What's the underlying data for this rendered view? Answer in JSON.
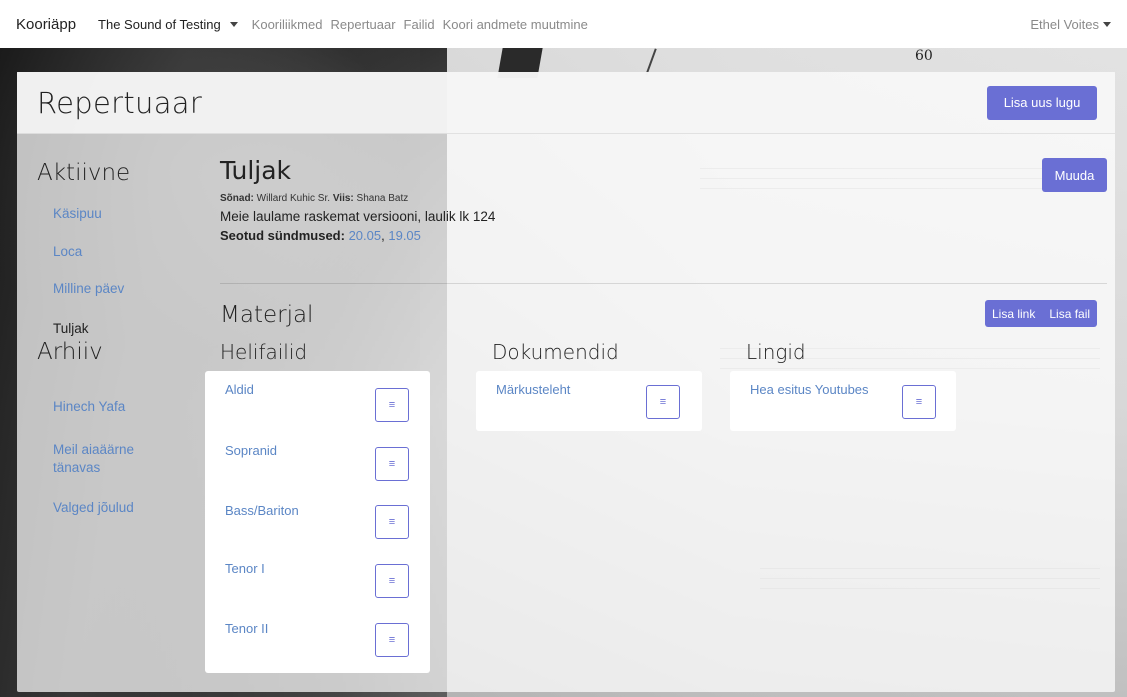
{
  "navbar": {
    "brand": "Kooriäpp",
    "choir": "The Sound of Testing",
    "links": [
      "Kooriliikmed",
      "Repertuaar",
      "Failid",
      "Koori andmete muutmine"
    ],
    "user": "Ethel Voites"
  },
  "page": {
    "title": "Repertuaar",
    "add_button": "Lisa uus lugu"
  },
  "sidebar": {
    "active_heading": "Aktiivne",
    "active_items": [
      "Käsipuu",
      "Loca",
      "Milline päev",
      "Tuljak"
    ],
    "selected": "Tuljak",
    "archive_heading": "Arhiiv",
    "archive_items": [
      "Hinech Yafa",
      "Meil aiaäärne tänavas",
      "Valged jõulud"
    ]
  },
  "song": {
    "title": "Tuljak",
    "lyrics_label": "Sõnad:",
    "lyrics_author": "Willard Kuhic Sr.",
    "music_label": "Viis:",
    "music_author": "Shana Batz",
    "description": "Meie laulame raskemat versiooni, laulik lk 124",
    "events_label": "Seotud sündmused:",
    "events": [
      "20.05",
      "19.05"
    ],
    "edit_button": "Muuda"
  },
  "material": {
    "heading": "Materjal",
    "add_link": "Lisa link",
    "add_file": "Lisa fail",
    "audio_heading": "Helifailid",
    "audio_files": [
      "Aldid",
      "Sopranid",
      "Bass/Bariton",
      "Tenor I",
      "Tenor II"
    ],
    "docs_heading": "Dokumendid",
    "documents": [
      "Märkusteleht"
    ],
    "links_heading": "Lingid",
    "links": [
      "Hea esitus Youtubes"
    ]
  },
  "icons": {
    "menu": "menu-lines-icon",
    "caret": "caret-down-icon"
  },
  "colors": {
    "accent": "#6a6fd4",
    "link": "#5b86c5"
  }
}
